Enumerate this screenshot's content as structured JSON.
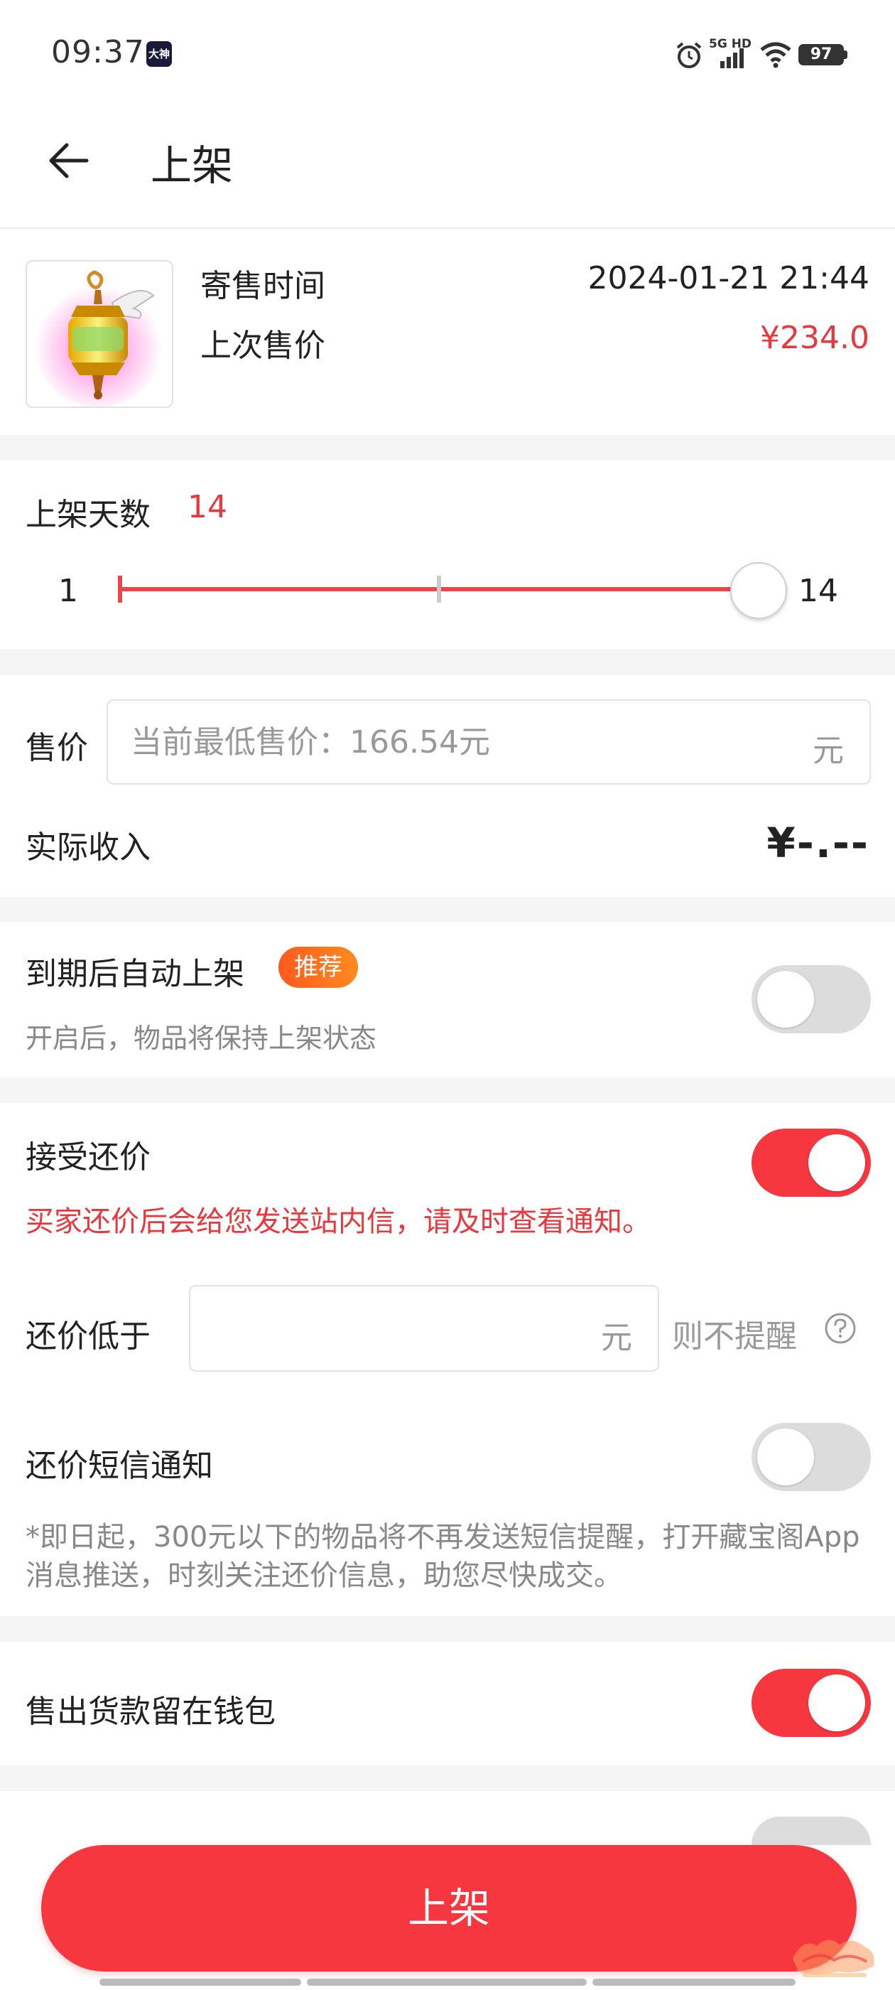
{
  "status_bar": {
    "time": "09:37",
    "app_badge": "大神",
    "network": "5G HD",
    "battery": "97",
    "icons": [
      "alarm-icon",
      "signal-icon",
      "wifi-icon",
      "battery-icon"
    ]
  },
  "header": {
    "title": "上架",
    "back_icon": "arrow-left-icon"
  },
  "item": {
    "image_icon": "winged-lantern-item-icon",
    "time_label": "寄售时间",
    "time_value": "2024-01-21 21:44",
    "last_price_label": "上次售价",
    "last_price_value": "¥234.0"
  },
  "duration": {
    "label": "上架天数",
    "value": "14",
    "min_label": "1",
    "max_label": "14",
    "min": 1,
    "max": 14,
    "selected": 14
  },
  "price": {
    "label": "售价",
    "placeholder": "当前最低售价：166.54元",
    "value": "",
    "unit": "元",
    "income_label": "实际收入",
    "income_value": "¥-.--"
  },
  "auto_relist": {
    "label": "到期后自动上架",
    "tag": "推荐",
    "description": "开启后，物品将保持上架状态",
    "enabled": false
  },
  "counter_offer": {
    "label": "接受还价",
    "enabled": true,
    "warning": "买家还价后会给您发送站内信，请及时查看通知。",
    "threshold_label": "还价低于",
    "threshold_value": "",
    "threshold_unit": "元",
    "threshold_suffix": "则不提醒",
    "help_icon": "question-circle-icon"
  },
  "sms_notice": {
    "label": "还价短信通知",
    "enabled": false,
    "note": "*即日起，300元以下的物品将不再发送短信提醒，打开藏宝阁App消息推送，时刻关注还价信息，助您尽快成交。"
  },
  "wallet": {
    "label": "售出货款留在钱包",
    "enabled": true
  },
  "submit": {
    "label": "上架"
  },
  "colors": {
    "accent": "#f6373f",
    "price_red": "#e8373d",
    "tag_orange": "#ff6a1e",
    "toggle_off": "#dcdcdc",
    "section_gap": "#f5f5f5"
  }
}
